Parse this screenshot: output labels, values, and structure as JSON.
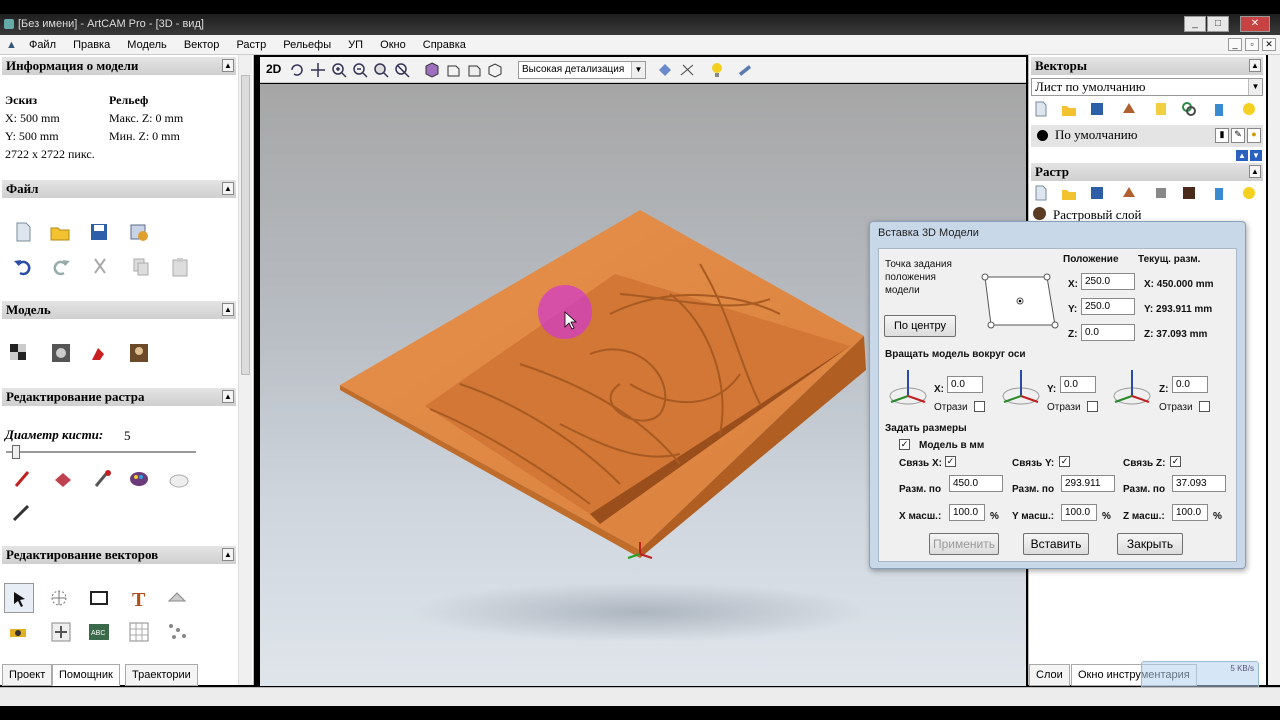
{
  "window": {
    "title": "[Без имени] - ArtCAM Pro - [3D - вид]",
    "min": "_",
    "max": "□",
    "close": "✕"
  },
  "menu": [
    "Файл",
    "Правка",
    "Модель",
    "Вектор",
    "Растр",
    "Рельефы",
    "УП",
    "Окно",
    "Справка"
  ],
  "mdi_buttons": [
    "_",
    "▫",
    "✕"
  ],
  "model_info": {
    "header": "Информация о модели",
    "sketch_label": "Эскиз",
    "relief_label": "Рельеф",
    "x": "X: 500 mm",
    "y": "Y: 500 mm",
    "max_z": "Макс. Z: 0 mm",
    "min_z": "Мин. Z: 0 mm",
    "pixels": "2722 x 2722 пикс."
  },
  "sections": {
    "file": "Файл",
    "model": "Модель",
    "raster_edit": "Редактирование растра",
    "vector_edit": "Редактирование векторов"
  },
  "brush": {
    "label": "Диаметр кисти:",
    "value": "5"
  },
  "left_tabs": [
    "Проект",
    "Помощник",
    "Траектории"
  ],
  "view_toolbar": {
    "mode_2d": "2D",
    "detail": "Высокая детализация"
  },
  "right": {
    "vectors_header": "Векторы",
    "sheet_select": "Лист по умолчанию",
    "default_layer": "По умолчанию",
    "raster_header": "Растр",
    "raster_layer": "Растровый слой",
    "tabs": [
      "Слои",
      "Окно инструментария"
    ],
    "net_speed": "5 KB/s"
  },
  "dialog": {
    "title": "Вставка 3D Модели",
    "anchor_label_1": "Точка задания",
    "anchor_label_2": "положения",
    "anchor_label_3": "модели",
    "position_header": "Положение",
    "size_header": "Текущ. разм.",
    "x_label": "X:",
    "y_label": "Y:",
    "z_label": "Z:",
    "pos_x": "250.0",
    "pos_y": "250.0",
    "pos_z": "0.0",
    "size_x": "X: 450.000 mm",
    "size_y": "Y: 293.911 mm",
    "size_z": "Z: 37.093 mm",
    "center_button": "По центру",
    "rotate_header": "Вращать модель вокруг оси",
    "rot_x": "0.0",
    "rot_y": "0.0",
    "rot_z": "0.0",
    "mirror_label": "Отрази",
    "resize_header": "Задать размеры",
    "model_mm_label": "Модель в мм",
    "link_x": "Связь X:",
    "link_y": "Связь Y:",
    "link_z": "Связь Z:",
    "size_by": "Разм. по",
    "dim_x": "450.0",
    "dim_y": "293.911",
    "dim_z": "37.093",
    "scale_x_label": "X масш.:",
    "scale_y_label": "Y масш.:",
    "scale_z_label": "Z масш.:",
    "scale_x": "100.0",
    "scale_y": "100.0",
    "scale_z": "100.0",
    "percent": "%",
    "check": "✓",
    "apply_button": "Применить",
    "insert_button": "Вставить",
    "close_button": "Закрыть"
  }
}
